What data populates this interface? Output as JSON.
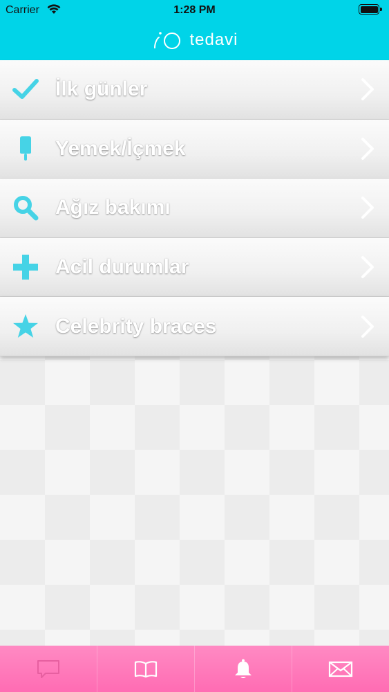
{
  "status_bar": {
    "carrier": "Carrier",
    "time": "1:28 PM"
  },
  "header": {
    "title": "tedavi",
    "background_color": "#00d4e8"
  },
  "menu": {
    "items": [
      {
        "label": "İlk günler",
        "icon": "checkmark-icon"
      },
      {
        "label": "Yemek/İçmek",
        "icon": "popsicle-icon"
      },
      {
        "label": "Ağız bakımı",
        "icon": "magnifier-icon"
      },
      {
        "label": "Acil durumlar",
        "icon": "plus-icon"
      },
      {
        "label": "Celebrity braces",
        "icon": "star-icon"
      }
    ],
    "icon_color": "#46d3e6"
  },
  "tab_bar": {
    "tabs": [
      {
        "icon": "chat-icon",
        "selected": true
      },
      {
        "icon": "book-icon",
        "selected": false
      },
      {
        "icon": "bell-icon",
        "selected": false
      },
      {
        "icon": "mail-icon",
        "selected": false
      }
    ],
    "background_color": "#ff7abb"
  }
}
